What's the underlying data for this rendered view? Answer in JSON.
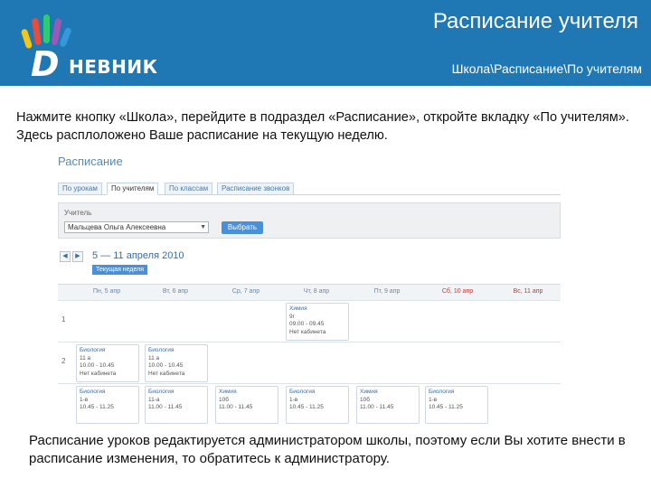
{
  "header": {
    "logo_letter": "D",
    "logo_word": "НЕВНИК",
    "title": "Расписание учителя",
    "breadcrumb": "Школа\\Расписание\\По учителям",
    "colors": {
      "background": "#1f78b4",
      "text": "#ffffff"
    }
  },
  "instruction": "Нажмите кнопку «Школа», перейдите в подраздел «Расписание», откройте вкладку «По учителям». Здесь расплоложено Ваше расписание на текущую неделю.",
  "screenshot": {
    "title": "Расписание",
    "tabs": [
      {
        "label": "По урокам",
        "active": false
      },
      {
        "label": "По учителям",
        "active": true
      },
      {
        "label": "По классам",
        "active": false
      },
      {
        "label": "Расписание звонков",
        "active": false
      }
    ],
    "filter": {
      "label": "Учитель",
      "selected": "Мальцева Ольга Алексеевна",
      "button": "Выбрать"
    },
    "nav": {
      "prev_icon": "arrow-left-icon",
      "next_icon": "arrow-right-icon"
    },
    "week_range": "5 — 11 апреля 2010",
    "current_week_button": "Текущая неделя",
    "days": [
      {
        "label": "Пн, 5 апр",
        "weekend": false
      },
      {
        "label": "Вт, 6 апр",
        "weekend": false
      },
      {
        "label": "Ср, 7 апр",
        "weekend": false
      },
      {
        "label": "Чт, 8 апр",
        "weekend": false
      },
      {
        "label": "Пт, 9 апр",
        "weekend": false
      },
      {
        "label": "Сб, 10 апр",
        "weekend": true
      },
      {
        "label": "Вс, 11 апр",
        "weekend": true
      }
    ],
    "rows": [
      {
        "number": "1",
        "lessons": [
          {
            "day": 3,
            "subject": "Химия",
            "class": "9г",
            "time": "09.00 - 09.45",
            "room": "Нет кабинета"
          }
        ]
      },
      {
        "number": "2",
        "lessons": [
          {
            "day": 0,
            "subject": "Биология",
            "class": "11 а",
            "time": "10.00 - 10.45",
            "room": "Нет кабинета"
          },
          {
            "day": 1,
            "subject": "Биология",
            "class": "11 а",
            "time": "10.00 - 10.45",
            "room": "Нет кабинета"
          }
        ]
      },
      {
        "number": "",
        "lessons": [
          {
            "day": 0,
            "subject": "Биология",
            "class": "1-в",
            "time": "10.45 - 11.25",
            "room": ""
          },
          {
            "day": 1,
            "subject": "Биология",
            "class": "11-а",
            "time": "11.00 - 11.45",
            "room": ""
          },
          {
            "day": 2,
            "subject": "Химия",
            "class": "10б",
            "time": "11.00 - 11.45",
            "room": ""
          },
          {
            "day": 3,
            "subject": "Биология",
            "class": "1-в",
            "time": "10.45 - 11.25",
            "room": ""
          },
          {
            "day": 4,
            "subject": "Химия",
            "class": "10б",
            "time": "11.00 - 11.45",
            "room": ""
          },
          {
            "day": 5,
            "subject": "Биология",
            "class": "1-в",
            "time": "10.45 - 11.25",
            "room": ""
          }
        ]
      }
    ]
  },
  "footer": "Расписание уроков редактируется администратором школы, поэтому если Вы хотите внести в расписание изменения, то обратитесь к администратору."
}
